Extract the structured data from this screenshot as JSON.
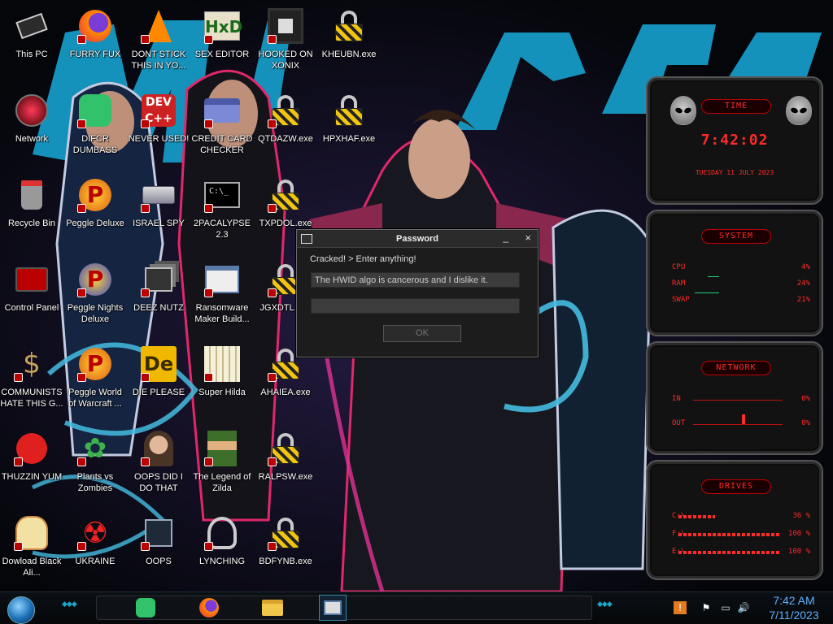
{
  "desktop": {
    "icons": [
      {
        "label": "This PC",
        "icon": "this-pc-icon"
      },
      {
        "label": "FURRY FUX",
        "icon": "firefox-icon"
      },
      {
        "label": "DONT STICK THIS IN YO...",
        "icon": "vlc-cone-icon"
      },
      {
        "label": "SEX EDITOR",
        "icon": "hxd-editor-icon"
      },
      {
        "label": "HOOKED ON XONIX",
        "icon": "xonix-game-icon"
      },
      {
        "label": "KHEUBN.exe",
        "icon": "lock-icon"
      },
      {
        "label": "Network",
        "icon": "network-icon"
      },
      {
        "label": "DIFCR DUMBASS",
        "icon": "discord-icon"
      },
      {
        "label": "NEVER USED!",
        "icon": "dev-cpp-icon"
      },
      {
        "label": "CREDIT CARD CHECKER",
        "icon": "credit-card-icon"
      },
      {
        "label": "QTDAZW.exe",
        "icon": "lock-icon"
      },
      {
        "label": "HPXHAF.exe",
        "icon": "lock-icon"
      },
      {
        "label": "Recycle Bin",
        "icon": "recycle-bin-icon"
      },
      {
        "label": "Peggle Deluxe",
        "icon": "peggle-icon"
      },
      {
        "label": "ISRAEL SPY",
        "icon": "network-drive-icon"
      },
      {
        "label": "2PACALYPSE 2.3",
        "icon": "cmd-icon"
      },
      {
        "label": "TXPDOL.exe",
        "icon": "lock-icon"
      },
      {
        "label": "Control Panel",
        "icon": "control-panel-icon"
      },
      {
        "label": "Peggle Nights Deluxe",
        "icon": "peggle-icon"
      },
      {
        "label": "DEEZ NUTZ",
        "icon": "stacked-windows-icon"
      },
      {
        "label": "Ransomware Maker Build...",
        "icon": "window-app-icon"
      },
      {
        "label": "JGXDTL.exe",
        "icon": "lock-icon"
      },
      {
        "label": "COMMUNISTS HATE THIS G...",
        "icon": "money-bag-icon"
      },
      {
        "label": "Peggle World of Warcraft ...",
        "icon": "peggle-icon"
      },
      {
        "label": "DIE PLEASE",
        "icon": "de-logo-icon"
      },
      {
        "label": "Super Hilda",
        "icon": "pixel-game-icon"
      },
      {
        "label": "AHAIEA.exe",
        "icon": "lock-icon"
      },
      {
        "label": "THUZZIN YUM",
        "icon": "red-creature-icon"
      },
      {
        "label": "Plants vs Zombies",
        "icon": "plants-vs-zombies-icon"
      },
      {
        "label": "OOPS DID I DO THAT",
        "icon": "portrait-icon"
      },
      {
        "label": "The Legend of Zilda",
        "icon": "pixel-hero-icon"
      },
      {
        "label": "RALPSW.exe",
        "icon": "lock-icon"
      },
      {
        "label": "Dowload Black Ali...",
        "icon": "anime-char-icon"
      },
      {
        "label": "UKRAINE",
        "icon": "radiation-icon"
      },
      {
        "label": "OOPS",
        "icon": "terminal-box-icon"
      },
      {
        "label": "LYNCHING",
        "icon": "cable-icon"
      },
      {
        "label": "BDFYNB.exe",
        "icon": "lock-icon"
      }
    ]
  },
  "dialog": {
    "title": "Password",
    "message": "Cracked! > Enter anything!",
    "field1_value": "The HWID algo is cancerous and I dislike it.",
    "field2_value": "",
    "ok_label": "OK",
    "minimize": "_",
    "close": "×"
  },
  "hud": {
    "time": {
      "header": "TIME",
      "clock": "7:42:02",
      "date": "TUESDAY 11 JULY 2023"
    },
    "system": {
      "header": "SYSTEM",
      "rows": [
        {
          "key": "CPU",
          "value": "4%"
        },
        {
          "key": "RAM",
          "value": "24%"
        },
        {
          "key": "SWAP",
          "value": "21%"
        }
      ]
    },
    "network": {
      "header": "NETWORK",
      "rows": [
        {
          "key": "IN",
          "value": "0%"
        },
        {
          "key": "OUT",
          "value": "0%"
        }
      ]
    },
    "drives": {
      "header": "DRIVES",
      "rows": [
        {
          "key": "C:\\",
          "value": "36 %",
          "fill": 0.36
        },
        {
          "key": "F:\\",
          "value": "100 %",
          "fill": 1.0
        },
        {
          "key": "E:\\",
          "value": "100 %",
          "fill": 1.0
        }
      ]
    }
  },
  "taskbar": {
    "apps": [
      "discord-icon",
      "firefox-icon",
      "file-explorer-icon",
      "active-window-icon"
    ],
    "tray": [
      "warning-shield-icon",
      "flag-icon",
      "network-status-icon",
      "volume-icon"
    ],
    "time": "7:42 AM",
    "date": "7/11/2023"
  },
  "colors": {
    "hud_red": "#ff2a2a",
    "clock_blue": "#5fb0ff",
    "wallpaper_cyan": "#19a7d6"
  }
}
